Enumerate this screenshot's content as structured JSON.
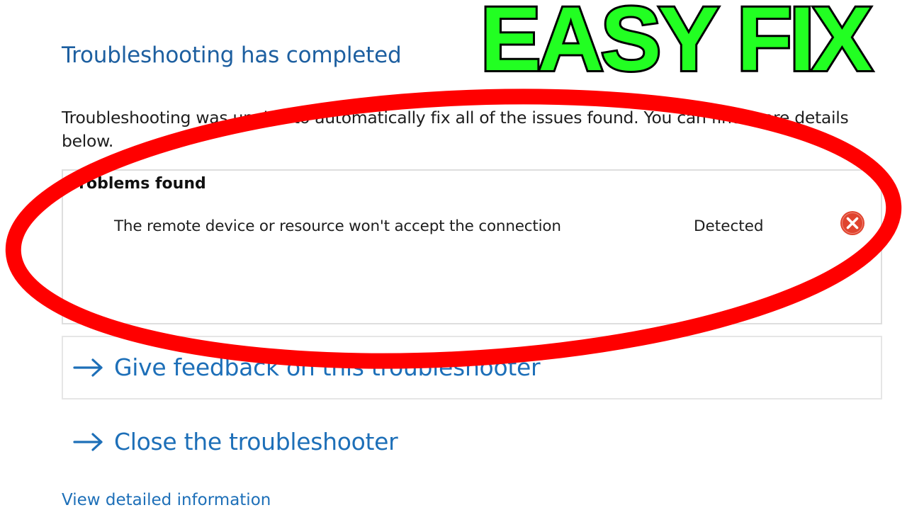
{
  "header": {
    "title": "Troubleshooting has completed",
    "description": "Troubleshooting was unable to automatically fix all of the issues found. You can find more details below."
  },
  "problems": {
    "heading": "Problems found",
    "items": [
      {
        "text": "The remote device or resource won't accept the connection",
        "status": "Detected",
        "icon": "error-icon",
        "icon_color": "#e0442f"
      }
    ]
  },
  "actions": {
    "feedback_label": "Give feedback on this troubleshooter",
    "close_label": "Close the troubleshooter",
    "details_link": "View detailed information"
  },
  "overlay": {
    "caption": "EASY FIX",
    "caption_color": "#22ff22",
    "ellipse_color": "#ff0000"
  },
  "colors": {
    "title": "#1d5fa0",
    "link": "#1d6fb8",
    "text": "#1e1e1e"
  }
}
